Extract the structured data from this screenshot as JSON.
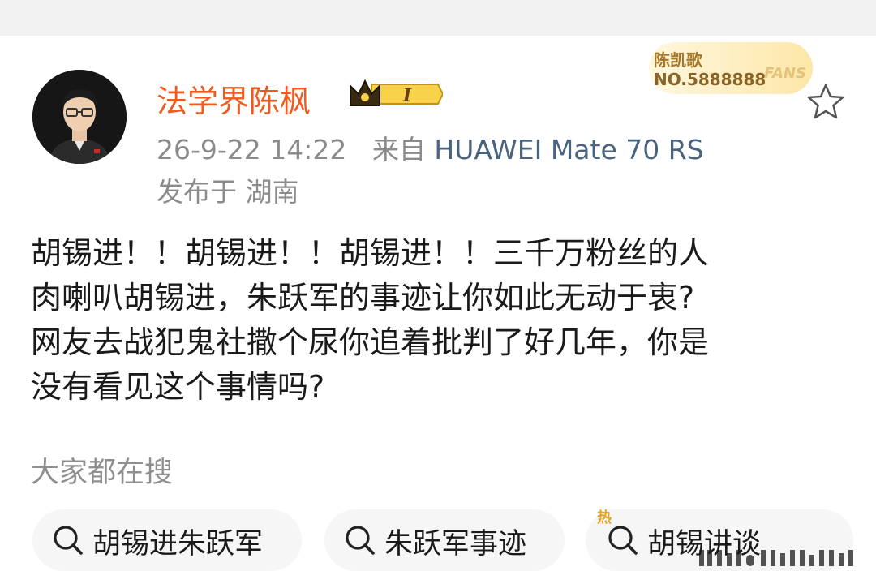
{
  "post": {
    "author": "法学界陈枫",
    "level_badge": "I",
    "fan_badge": {
      "name": "陈凯歌",
      "number": "NO.5888888",
      "tag": "FANS"
    },
    "time": "26-9-22 14:22",
    "source_prefix": "来自",
    "device": "HUAWEI Mate 70 RS",
    "location": "发布于 湖南",
    "content": "胡锡进！！胡锡进！！胡锡进！！三千万粉丝的人\n肉喇叭胡锡进，朱跃军的事迹让你如此无动于衷?\n网友去战犯鬼社撒个尿你追着批判了好几年，你是\n没有看见这个事情吗?"
  },
  "search": {
    "title": "大家都在搜",
    "chips": [
      {
        "label": "胡锡进朱跃军",
        "icon": "search-icon"
      },
      {
        "label": "朱跃军事迹",
        "icon": "search-icon"
      },
      {
        "label": "胡锡讲谈",
        "icon": "hot-search-icon",
        "badge": "热"
      }
    ]
  },
  "colors": {
    "author": "#f05a1e",
    "device": "#4a6380",
    "meta": "#8b8b8b"
  }
}
